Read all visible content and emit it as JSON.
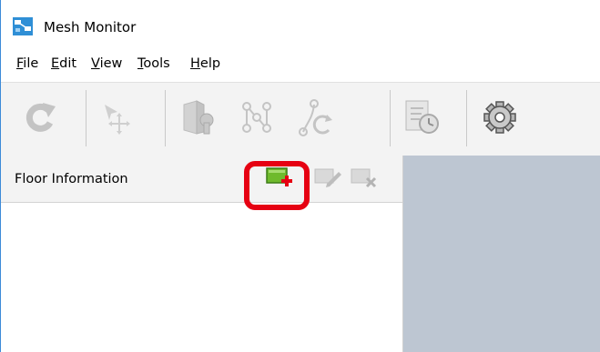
{
  "window": {
    "title": "Mesh Monitor",
    "app_icon": "mesh-monitor-app-icon"
  },
  "menu": {
    "items": [
      {
        "label_mnemonic": "F",
        "label_rest": "ile"
      },
      {
        "label_mnemonic": "E",
        "label_rest": "dit"
      },
      {
        "label_mnemonic": "V",
        "label_rest": "iew"
      },
      {
        "label_mnemonic": "T",
        "label_rest": "ools"
      },
      {
        "label_mnemonic": "H",
        "label_rest": "elp"
      }
    ]
  },
  "toolbar": {
    "buttons": [
      {
        "icon": "refresh-icon",
        "enabled": false
      },
      {
        "icon": "move-cursor-icon",
        "enabled": false
      },
      {
        "icon": "device-settings-icon",
        "enabled": false
      },
      {
        "icon": "node-link-icon",
        "enabled": false
      },
      {
        "icon": "route-icon",
        "enabled": false
      },
      {
        "icon": "history-log-icon",
        "enabled": false
      },
      {
        "icon": "gear-icon",
        "enabled": true
      }
    ]
  },
  "panel": {
    "title": "Floor Information",
    "actions": [
      {
        "icon": "add-floor-icon",
        "enabled": true,
        "highlighted": true
      },
      {
        "icon": "edit-floor-icon",
        "enabled": false
      },
      {
        "icon": "delete-floor-icon",
        "enabled": false
      }
    ]
  },
  "colors": {
    "highlight": "#e60012",
    "add_green": "#6fba2c",
    "canvas": "#bdc6d2",
    "toolbar_bg": "#f3f3f3"
  }
}
